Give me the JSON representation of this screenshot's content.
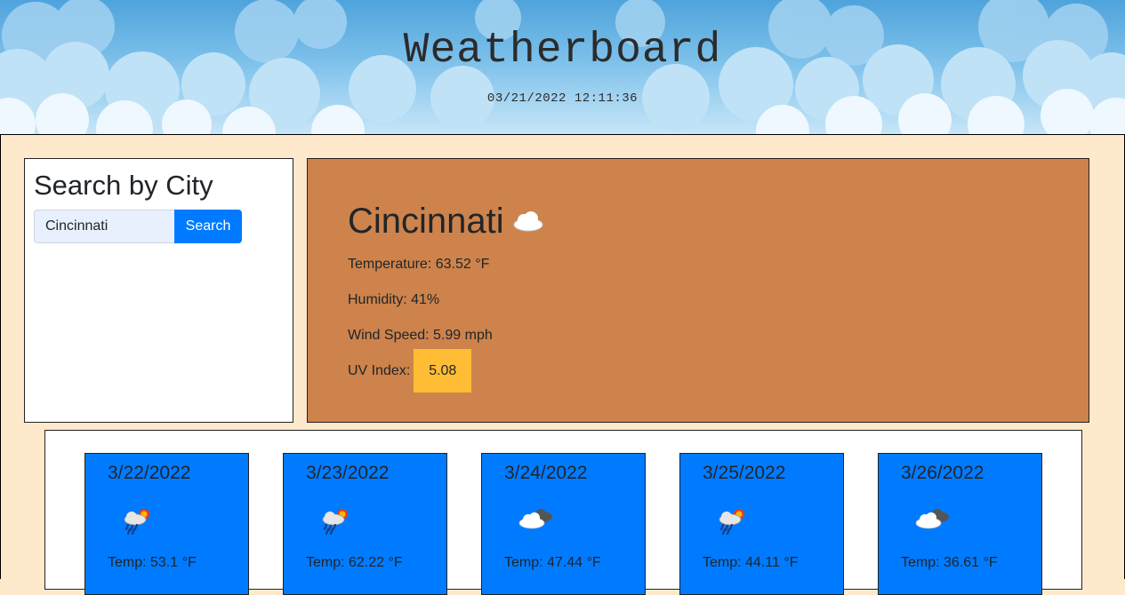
{
  "header": {
    "title": "Weatherboard",
    "datetime": "03/21/2022 12:11:36"
  },
  "search": {
    "title": "Search by City",
    "input_value": "Cincinnati",
    "button_label": "Search"
  },
  "current": {
    "city": "Cincinnati",
    "icon": "cloud-icon",
    "temperature": "Temperature: 63.52 °F",
    "humidity": "Humidity: 41%",
    "wind": "Wind Speed: 5.99 mph",
    "uv_label": "UV Index:",
    "uv_value": "5.08",
    "uv_color": "#ffbd35",
    "panel_color": "#cd834b"
  },
  "forecast": [
    {
      "date": "3/22/2022",
      "icon": "rain-sun-icon",
      "temp": "Temp: 53.1 °F"
    },
    {
      "date": "3/23/2022",
      "icon": "rain-sun-icon",
      "temp": "Temp: 62.22 °F"
    },
    {
      "date": "3/24/2022",
      "icon": "cloudy-icon",
      "temp": "Temp: 47.44 °F"
    },
    {
      "date": "3/25/2022",
      "icon": "rain-sun-icon",
      "temp": "Temp: 44.11 °F"
    },
    {
      "date": "3/26/2022",
      "icon": "cloudy-icon",
      "temp": "Temp: 36.61 °F"
    }
  ],
  "colors": {
    "accent": "#007bff",
    "background": "#ffe9cd"
  }
}
